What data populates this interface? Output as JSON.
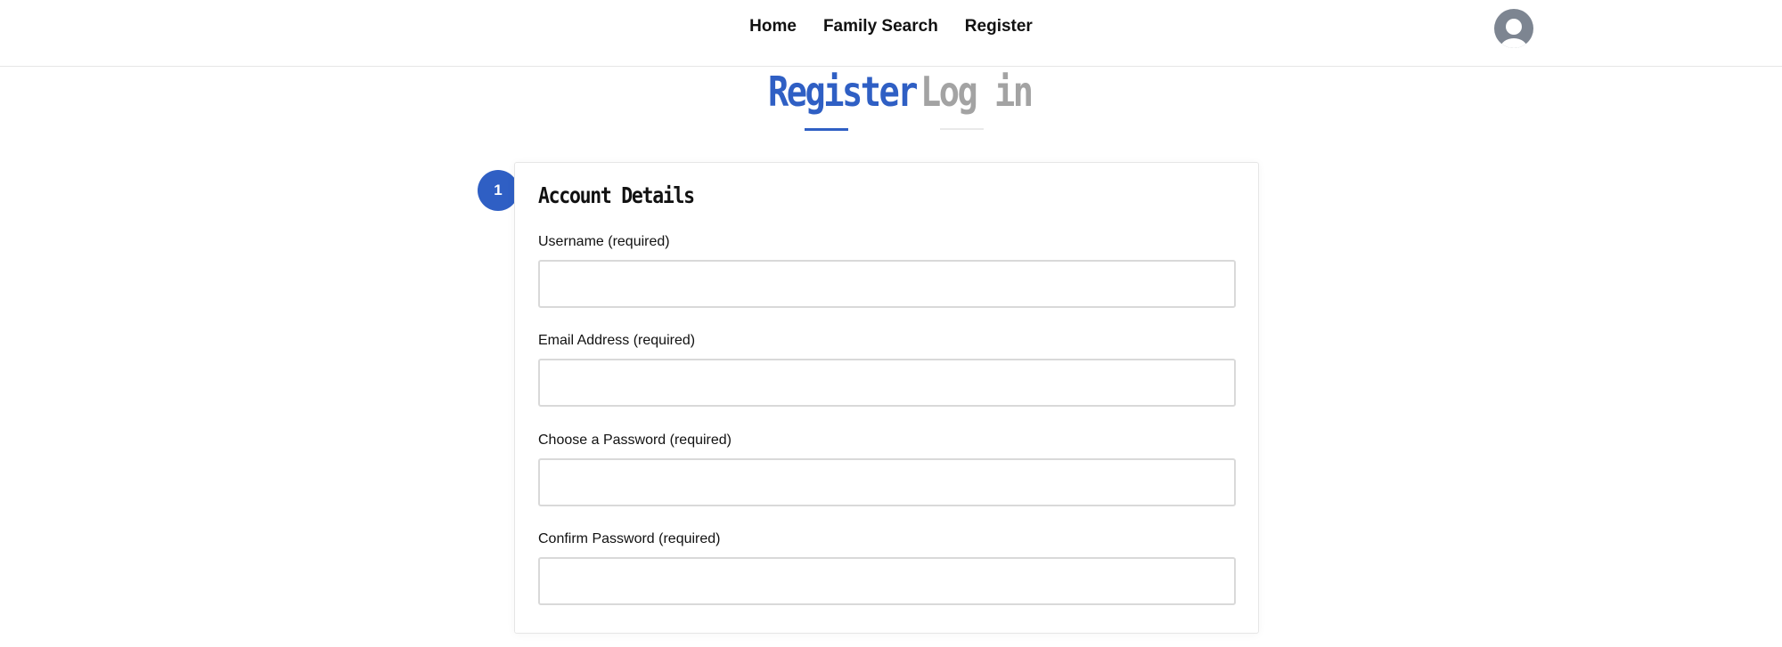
{
  "nav": {
    "items": [
      {
        "label": "Home"
      },
      {
        "label": "Family Search"
      },
      {
        "label": "Register"
      }
    ]
  },
  "user_menu": {
    "icon": "user-avatar-icon"
  },
  "auth_tabs": {
    "register": {
      "label": "Register",
      "active": true
    },
    "login": {
      "label": "Log in",
      "active": false
    }
  },
  "step": {
    "number": "1"
  },
  "form": {
    "title": "Account Details",
    "fields": [
      {
        "label": "Username (required)",
        "value": "",
        "placeholder": ""
      },
      {
        "label": "Email Address (required)",
        "value": "",
        "placeholder": ""
      },
      {
        "label": "Choose a Password (required)",
        "value": "",
        "placeholder": ""
      },
      {
        "label": "Confirm Password (required)",
        "value": "",
        "placeholder": ""
      }
    ]
  },
  "colors": {
    "accent": "#2f5fc4",
    "inactive_tab": "#a3a3a3",
    "avatar": "#7d8591"
  }
}
